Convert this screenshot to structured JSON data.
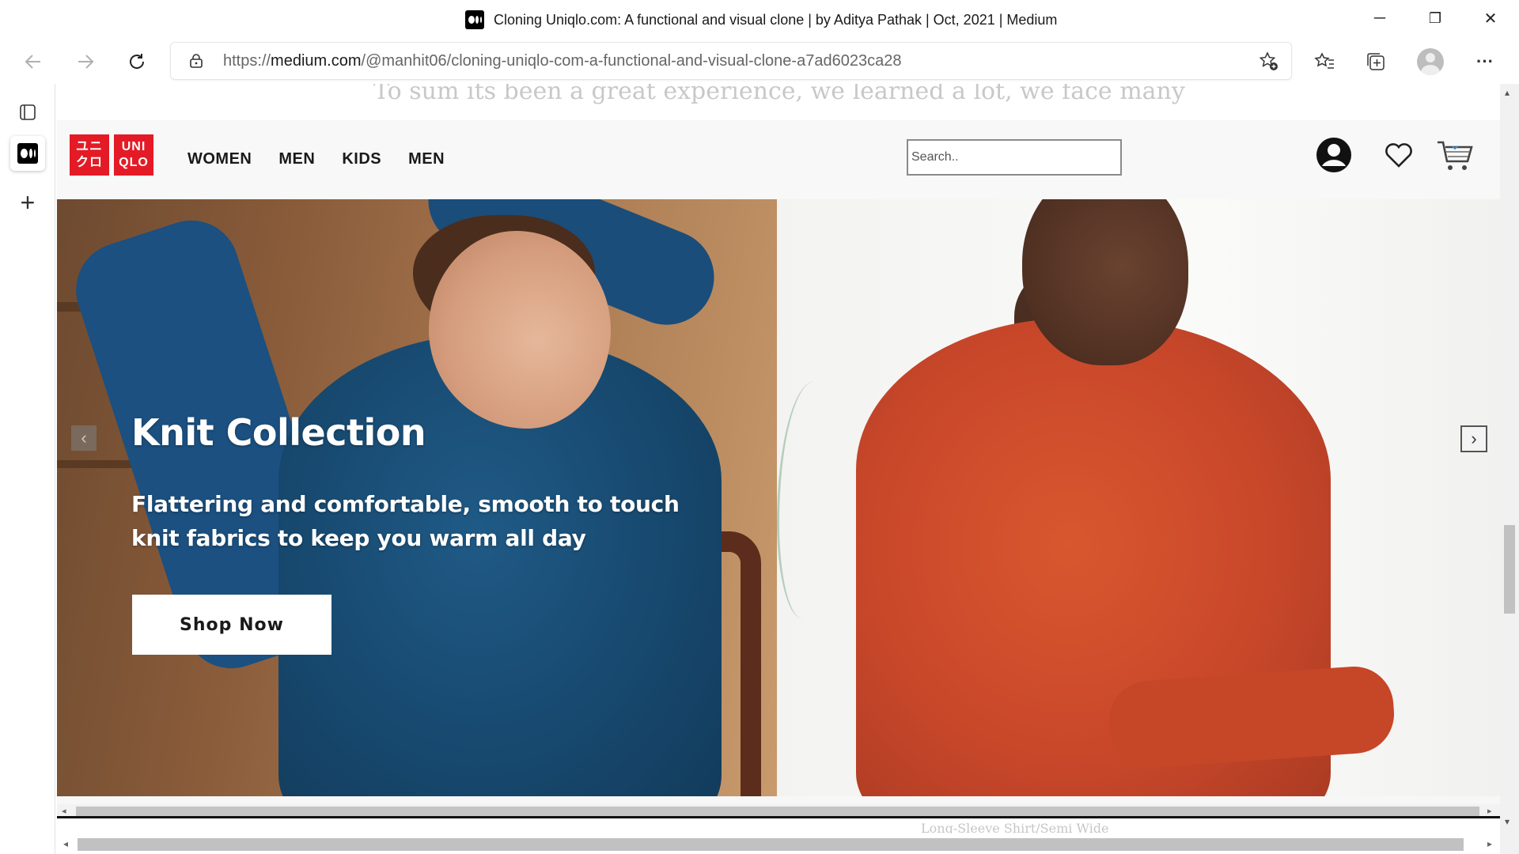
{
  "window": {
    "title": "Cloning Uniqlo.com: A functional and visual clone | by Aditya Pathak | Oct, 2021 | Medium",
    "minimize": "─",
    "restore": "❐",
    "close": "✕"
  },
  "address_bar": {
    "url_prefix": "https://",
    "url_domain": "medium.com",
    "url_path": "/@manhit06/cloning-uniqlo-com-a-functional-and-visual-clone-a7ad6023ca28",
    "more": "···"
  },
  "sidebar": {
    "add": "+"
  },
  "article_behind": {
    "top_text": "To sum its been a great experience, we learned a lot, we face many",
    "caption": "Long-Sleeve Shirt/Semi Wide"
  },
  "site": {
    "logo": {
      "line1a": "ユニ",
      "line1b": "クロ",
      "line2a": "UNI",
      "line2b": "QLO"
    },
    "nav": [
      "WOMEN",
      "MEN",
      "KIDS",
      "MEN"
    ],
    "search_placeholder": "Search.."
  },
  "hero": {
    "title": "Knit Collection",
    "subtitle": "Flattering and comfortable, smooth to touch knit fabrics to keep you warm all day",
    "button": "Shop Now",
    "prev": "‹",
    "next": "›"
  },
  "scroll": {
    "left": "◂",
    "right": "▸",
    "up": "▴",
    "down": "▾"
  },
  "colors": {
    "brand_red": "#e41b26",
    "sweater_blue": "#17486e",
    "sweater_orange": "#c8472a"
  }
}
